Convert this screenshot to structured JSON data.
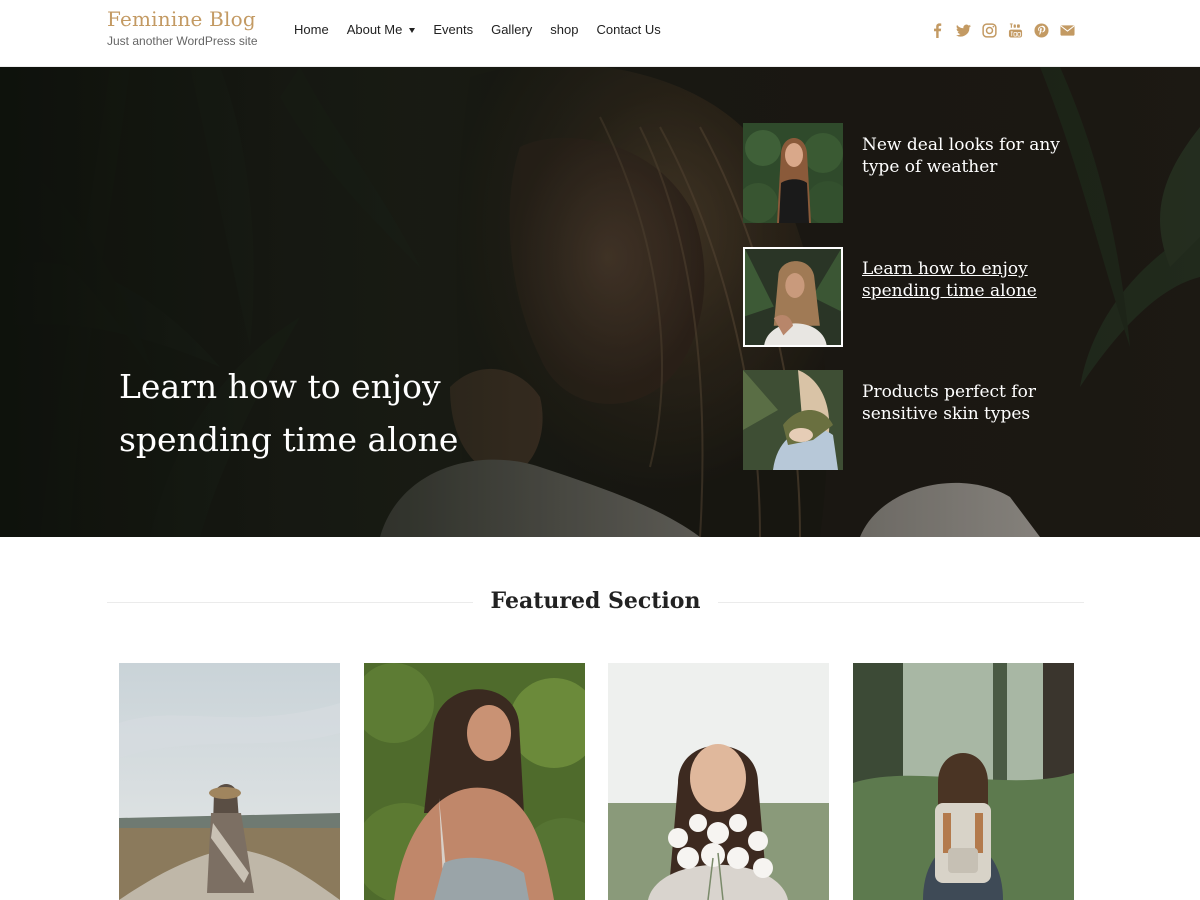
{
  "site": {
    "title": "Feminine Blog",
    "tagline": "Just another WordPress site"
  },
  "nav": {
    "items": [
      {
        "label": "Home"
      },
      {
        "label": "About Me",
        "has_dropdown": true
      },
      {
        "label": "Events"
      },
      {
        "label": "Gallery"
      },
      {
        "label": "shop"
      },
      {
        "label": "Contact Us"
      }
    ]
  },
  "social": {
    "icons": [
      "facebook-icon",
      "twitter-icon",
      "instagram-icon",
      "youtube-icon",
      "pinterest-icon",
      "envelope-icon"
    ],
    "color": "#c39a63"
  },
  "hero": {
    "main_title": "Learn how to enjoy spending time alone",
    "posts": [
      {
        "title": "New deal looks for any type of weather",
        "active": false
      },
      {
        "title": "Learn how to enjoy spending time alone",
        "active": true
      },
      {
        "title": "Products perfect for sensitive skin types",
        "active": false
      }
    ]
  },
  "featured": {
    "heading": "Featured Section"
  },
  "colors": {
    "accent": "#c39a63",
    "text": "#222222",
    "hero_text": "#ffffff"
  }
}
